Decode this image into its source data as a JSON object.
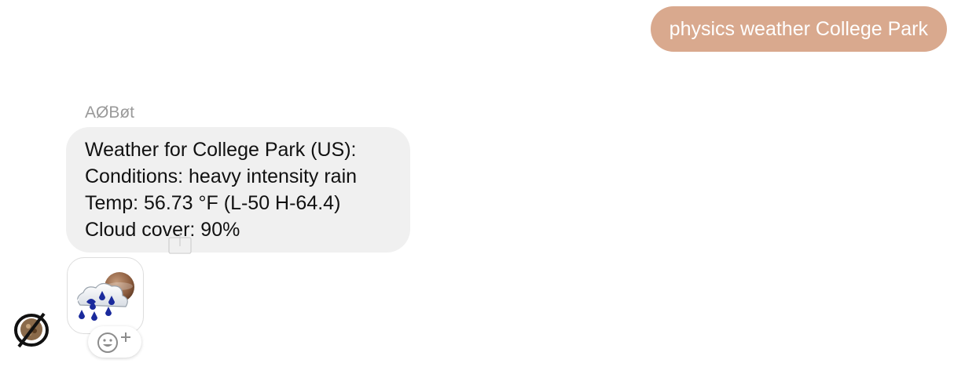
{
  "user_message": {
    "text": "physics weather College Park",
    "bubble_color": "#d9a98e"
  },
  "bot_message": {
    "sender": "AØBøt",
    "lines": [
      "Weather for College Park (US):",
      "Conditions: heavy intensity rain",
      "Temp: 56.73 °F (L-50 H-64.4)",
      "Cloud cover: 90%"
    ],
    "bubble_color": "#f0f0f0"
  },
  "attachment": {
    "icon": "heavy-rain-night-icon"
  },
  "reaction": {
    "icon": "add-reaction-icon"
  },
  "avatar": {
    "icon": "bot-avatar-icon"
  },
  "share": {
    "icon": "share-icon"
  }
}
